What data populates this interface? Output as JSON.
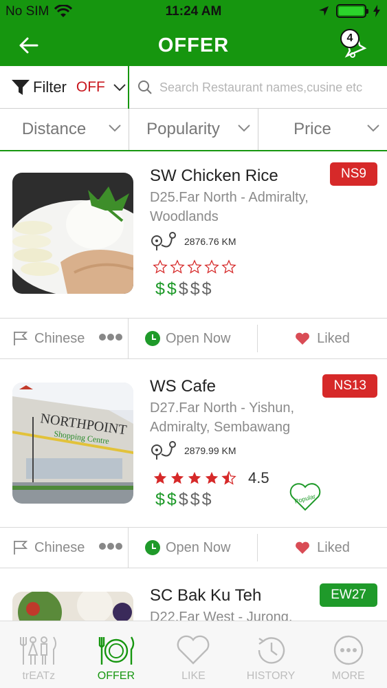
{
  "status_bar": {
    "carrier": "No SIM",
    "time": "11:24 AM"
  },
  "header": {
    "title": "OFFER",
    "notification_count": "4"
  },
  "filter": {
    "label": "Filter",
    "state": "OFF"
  },
  "search": {
    "placeholder": "Search Restaurant names,cusine etc"
  },
  "sort_options": [
    "Distance",
    "Popularity",
    "Price"
  ],
  "restaurants": [
    {
      "name": "SW Chicken Rice",
      "address": "D25.Far North - Admiralty, Woodlands",
      "distance": "2876.76 KM",
      "tag": "NS9",
      "tag_color": "#d62929",
      "rating_stars": 0,
      "rating": "",
      "price_level": 2,
      "cuisine": "Chinese",
      "open_status": "Open Now",
      "liked": "Liked"
    },
    {
      "name": "WS Cafe",
      "address": "D27.Far North - Yishun, Admiralty, Sembawang",
      "distance": "2879.99 KM",
      "tag": "NS13",
      "tag_color": "#d62929",
      "rating_stars": 4.5,
      "rating": "4.5",
      "popular_label": "Popular",
      "price_level": 2,
      "cuisine": "Chinese",
      "open_status": "Open Now",
      "liked": "Liked",
      "photo_text": "NORTHPOINT Shopping Centre"
    },
    {
      "name": "SC Bak Ku Teh",
      "address": "D22.Far West - Jurong,",
      "tag": "EW27",
      "tag_color": "#1f9a2a"
    }
  ],
  "tabs": [
    {
      "label": "trEATz",
      "icon": "utensils-people-icon",
      "active": false
    },
    {
      "label": "OFFER",
      "icon": "plate-cutlery-icon",
      "active": true
    },
    {
      "label": "LIKE",
      "icon": "heart-outline-icon",
      "active": false
    },
    {
      "label": "HISTORY",
      "icon": "history-clock-icon",
      "active": false
    },
    {
      "label": "MORE",
      "icon": "more-dots-icon",
      "active": false
    }
  ],
  "colors": {
    "brand_green": "#16960f",
    "tag_red": "#d62929",
    "price_green": "#1f9a2a"
  }
}
